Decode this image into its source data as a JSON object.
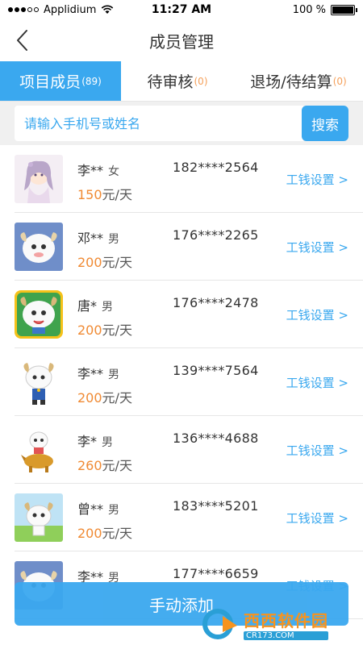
{
  "status_bar": {
    "carrier": "Applidium",
    "time": "11:27 AM",
    "battery": "100 %",
    "signal_dots": 5
  },
  "nav": {
    "title": "成员管理",
    "back_icon": "chevron-left-icon"
  },
  "tabs": [
    {
      "label": "项目成员",
      "count": "(89)",
      "active": true
    },
    {
      "label": "待审核",
      "count": "(0)",
      "active": false
    },
    {
      "label": "退场/待结算",
      "count": "(0)",
      "active": false
    }
  ],
  "search": {
    "placeholder": "请输入手机号或姓名",
    "value": "",
    "button_label": "搜索"
  },
  "members": [
    {
      "name": "李**",
      "gender": "女",
      "phone": "182****2564",
      "wage": "150",
      "unit": "元/天",
      "setting": "工钱设置 >",
      "avatar": "anime-girl"
    },
    {
      "name": "邓**",
      "gender": "男",
      "phone": "176****2265",
      "wage": "200",
      "unit": "元/天",
      "setting": "工钱设置 >",
      "avatar": "sheep-blue"
    },
    {
      "name": "唐*",
      "gender": "男",
      "phone": "176****2478",
      "wage": "200",
      "unit": "元/天",
      "setting": "工钱设置 >",
      "avatar": "sheep-yellow"
    },
    {
      "name": "李**",
      "gender": "男",
      "phone": "139****7564",
      "wage": "200",
      "unit": "元/天",
      "setting": "工钱设置 >",
      "avatar": "sheep-white"
    },
    {
      "name": "李*",
      "gender": "男",
      "phone": "136****4688",
      "wage": "260",
      "unit": "元/天",
      "setting": "工钱设置 >",
      "avatar": "sheep-riding"
    },
    {
      "name": "曾**",
      "gender": "男",
      "phone": "183****5201",
      "wage": "200",
      "unit": "元/天",
      "setting": "工钱设置 >",
      "avatar": "sheep-field"
    },
    {
      "name": "李**",
      "gender": "男",
      "phone": "177****6659",
      "wage": "",
      "unit": "",
      "setting": "工钱设置 >",
      "avatar": "sheep-blue"
    }
  ],
  "bottom": {
    "add_label": "手动添加"
  },
  "watermark": {
    "brand": "西西软件园",
    "site": "CR173.COM"
  },
  "colors": {
    "accent": "#3aa8ef",
    "wage": "#f08a33",
    "count": "#f5a05a"
  }
}
